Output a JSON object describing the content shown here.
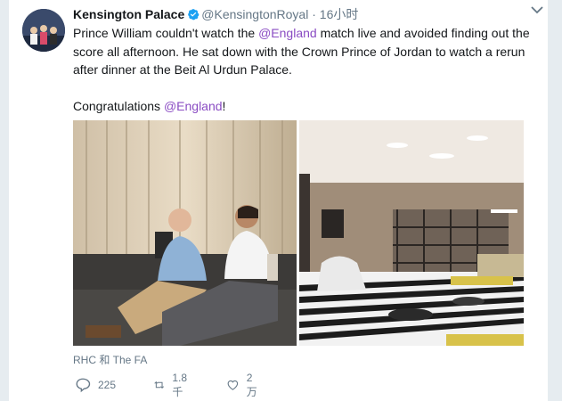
{
  "author": {
    "name": "Kensington Palace",
    "handle": "@KensingtonRoyal",
    "separator": "·",
    "time": "16小时"
  },
  "body": {
    "line1_pre": "Prince William couldn't watch the ",
    "mention1": "@England",
    "line1_post": " match live and avoided finding out the score all afternoon. He sat down with the Crown Prince of Jordan to watch a rerun after dinner at the Beit Al Urdun Palace.",
    "para2_pre": "Congratulations ",
    "mention2": "@England",
    "para2_post": "!"
  },
  "media_credit": "RHC 和 The FA",
  "actions": {
    "reply_count": "225",
    "retweet_count": "1.8千",
    "like_count": "2万"
  },
  "colors": {
    "mention": "#8a4cc3",
    "muted": "#657786",
    "verified": "#1da1f2"
  },
  "icons": [
    "verified-badge-icon",
    "chevron-down-icon",
    "reply-icon",
    "retweet-icon",
    "like-icon"
  ]
}
